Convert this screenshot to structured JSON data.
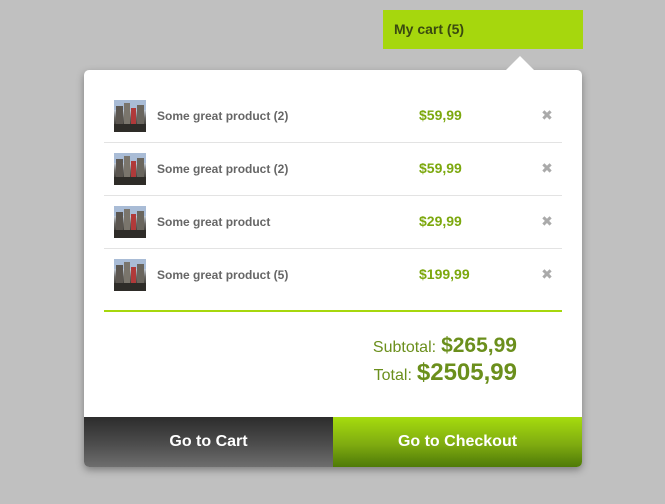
{
  "cart_toggle": {
    "label": "My cart (5)"
  },
  "items": [
    {
      "name": "Some great product (2)",
      "price": "$59,99",
      "remove": "✖"
    },
    {
      "name": "Some great product (2)",
      "price": "$59,99",
      "remove": "✖"
    },
    {
      "name": "Some great product",
      "price": "$29,99",
      "remove": "✖"
    },
    {
      "name": "Some great product (5)",
      "price": "$199,99",
      "remove": "✖"
    }
  ],
  "summary": {
    "subtotal_label": "Subtotal:",
    "subtotal_value": "$265,99",
    "total_label": "Total:",
    "total_value": "$2505,99"
  },
  "footer": {
    "cart_button": "Go to Cart",
    "checkout_button": "Go to Checkout"
  },
  "colors": {
    "accent": "#a6d70d",
    "price": "#7ca80e",
    "summary": "#6b8f1c",
    "background": "#c0c0c0"
  },
  "icons": {
    "item_image": "product-thumbnail",
    "remove": "close-icon"
  }
}
